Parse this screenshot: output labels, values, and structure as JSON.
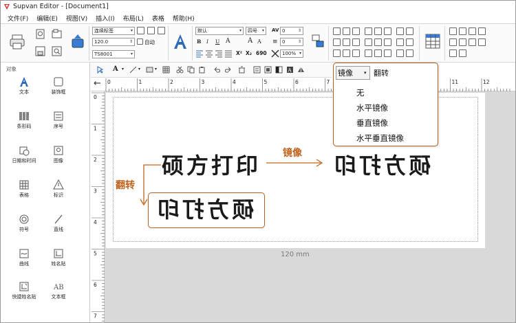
{
  "window": {
    "title": "Supvan Editor - [Document1]"
  },
  "menu": [
    "文件(F)",
    "编辑(E)",
    "视图(V)",
    "插入(I)",
    "布局(L)",
    "表格",
    "帮助(H)"
  ],
  "ribbon": {
    "label_type": "连续标签",
    "width_value": "120.0",
    "auto_label": "自动",
    "printer": "TS8001",
    "font_name": "默认",
    "font_size": "四号",
    "char_spacing": "0",
    "line_spacing": "0",
    "zoom": "100%",
    "bold": "B",
    "italic": "I",
    "underline": "U",
    "font_color": "A",
    "grow_font": "A",
    "shrink_font": "A",
    "superscript": "X²",
    "subscript": "X₂",
    "number_690": "690",
    "char_spacing_label": "AV",
    "line_spacing_label": "≡"
  },
  "sidebar": {
    "title": "对象",
    "tools": [
      {
        "label": "文本",
        "icon": "text-icon"
      },
      {
        "label": "装饰框",
        "icon": "frame-icon"
      },
      {
        "label": "条形码",
        "icon": "barcode-icon"
      },
      {
        "label": "序号",
        "icon": "serial-icon"
      },
      {
        "label": "日期和时间",
        "icon": "datetime-icon"
      },
      {
        "label": "图像",
        "icon": "image-icon"
      },
      {
        "label": "表格",
        "icon": "table-icon"
      },
      {
        "label": "标识",
        "icon": "warning-sign-icon"
      },
      {
        "label": "符号",
        "icon": "symbol-icon"
      },
      {
        "label": "直线",
        "icon": "line-icon"
      },
      {
        "label": "曲线",
        "icon": "curve-icon"
      },
      {
        "label": "姓名贴",
        "icon": "name-sticker-icon"
      },
      {
        "label": "快捷姓名贴",
        "icon": "quick-name-sticker-icon"
      },
      {
        "label": "文本框",
        "icon": "textbox-icon"
      }
    ]
  },
  "ruler": {
    "h_ticks": [
      "0",
      "1",
      "2",
      "3",
      "4",
      "5",
      "6",
      "7",
      "8",
      "9",
      "10",
      "11",
      "12"
    ],
    "v_ticks": [
      "0",
      "1",
      "2",
      "3",
      "4",
      "5",
      "6",
      "7"
    ]
  },
  "canvas": {
    "size_label": "120 mm",
    "original_text": "硕方打印",
    "mirror_text": "硕方打印",
    "flip_text": "硕方打印",
    "mirror_annotation": "镜像",
    "flip_annotation": "翻转"
  },
  "dropdown": {
    "current": "镜像",
    "sibling": "翻转",
    "options": [
      "无",
      "水平镜像",
      "垂直镜像",
      "水平垂直镜像"
    ]
  },
  "colors": {
    "accent": "#c0631f",
    "box_border": "#b85c1e"
  }
}
